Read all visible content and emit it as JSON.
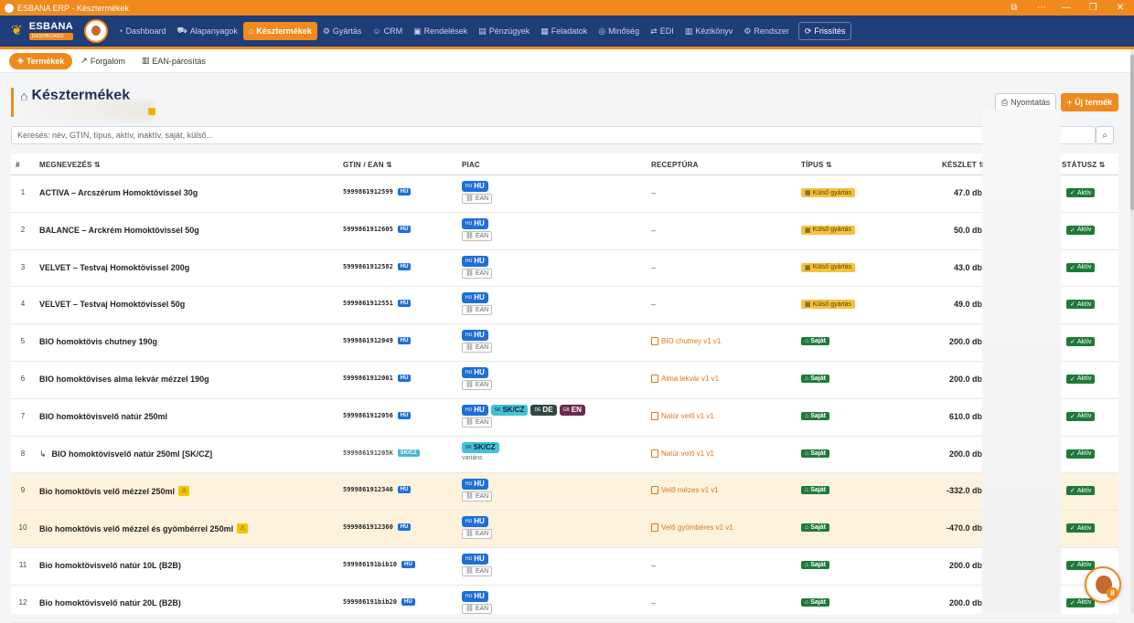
{
  "window": {
    "title": "ESBANA ERP - Késztermékek"
  },
  "brand": {
    "name": "ESBANA",
    "sub": "DASHBOARD"
  },
  "nav": {
    "items": [
      {
        "label": "Dashboard",
        "icon": "dashboard-icon"
      },
      {
        "label": "Alapanyagok",
        "icon": "cart-icon"
      },
      {
        "label": "Késztermékek",
        "icon": "tag-icon"
      },
      {
        "label": "Gyártás",
        "icon": "gear-icon"
      },
      {
        "label": "CRM",
        "icon": "users-icon"
      },
      {
        "label": "Rendelések",
        "icon": "inbox-icon"
      },
      {
        "label": "Pénzügyek",
        "icon": "money-icon"
      },
      {
        "label": "Feladatok",
        "icon": "board-icon"
      },
      {
        "label": "Minőség",
        "icon": "check-circle-icon"
      },
      {
        "label": "EDI",
        "icon": "transfer-icon"
      },
      {
        "label": "Kézikönyv",
        "icon": "book-icon"
      },
      {
        "label": "Rendszer",
        "icon": "settings-icon"
      }
    ],
    "refresh": "Frissítés"
  },
  "subnav": {
    "products": "Termékek",
    "turnover": "Forgalom",
    "ean_pairing": "EAN-párosítás"
  },
  "page": {
    "title": "Késztermékek",
    "print": "Nyomtatás",
    "new_product": "Új termék"
  },
  "search": {
    "placeholder": "Keresés: név, GTIN, típus, aktív, inaktív, saját, külső..."
  },
  "table": {
    "headers": {
      "idx": "#",
      "name": "MEGNEVEZÉS ⇅",
      "gtin": "GTIN / EAN ⇅",
      "market": "PIAC",
      "recipe": "RECEPTÚRA",
      "type": "TÍPUS ⇅",
      "stock": "KÉSZLET ⇅",
      "status": "STÁTUSZ ⇅"
    },
    "rows": [
      {
        "idx": "1",
        "name": "ACTIVA – Arcszérum Homoktövissel 30g",
        "gtin": "5999861912599",
        "recipe": "–",
        "type": "Külső gyártás",
        "stock": "47.0 db",
        "status": "Aktív"
      },
      {
        "idx": "2",
        "name": "BALANCE – Arckrém Homoktövissel 50g",
        "gtin": "5999861912605",
        "recipe": "–",
        "type": "Külső gyártás",
        "stock": "50.0 db",
        "status": "Aktív"
      },
      {
        "idx": "3",
        "name": "VELVET – Testvaj Homoktövissel 200g",
        "gtin": "5999861912582",
        "recipe": "–",
        "type": "Külső gyártás",
        "stock": "43.0 db",
        "status": "Aktív"
      },
      {
        "idx": "4",
        "name": "VELVET – Testvaj Homoktövissel 50g",
        "gtin": "5999861912551",
        "recipe": "–",
        "type": "Külső gyártás",
        "stock": "49.0 db",
        "status": "Aktív"
      },
      {
        "idx": "5",
        "name": "BIO homoktövis chutney 190g",
        "gtin": "5999861912049",
        "recipe": "BIO chutney v1 v1",
        "type": "Saját",
        "stock": "200.0 db",
        "status": "Aktív"
      },
      {
        "idx": "6",
        "name": "BIO homoktövises alma lekvár mézzel 190g",
        "gtin": "5999861912001",
        "recipe": "Alma lekvár v1 v1",
        "type": "Saját",
        "stock": "200.0 db",
        "status": "Aktív"
      },
      {
        "idx": "7",
        "name": "BIO homoktövisvelő natúr 250ml",
        "gtin": "5999861912056",
        "recipe": "Natúr velő v1 v1",
        "type": "Saját",
        "stock": "610.0 db",
        "status": "Aktív"
      },
      {
        "idx": "8",
        "variant_marker": "↳",
        "name": "BIO homoktövisvelő natúr 250ml [SK/CZ]",
        "gtin": "599986191205K",
        "gtin_tag": "SK/CZ",
        "variant_label": "variáns",
        "recipe": "Natúr velő v1 v1",
        "type": "Saját",
        "stock": "200.0 db",
        "status": "Aktív"
      },
      {
        "idx": "9",
        "name": "Bio homoktövis velő mézzel 250ml",
        "warn": "⚠",
        "gtin": "5999861912346",
        "recipe": "Velő mézes v1 v1",
        "type": "Saját",
        "stock": "-332.0 db",
        "status": "Aktív"
      },
      {
        "idx": "10",
        "name": "Bio homoktövis velő mézzel és gyömbérrel 250ml",
        "warn": "⚠",
        "gtin": "5999861912360",
        "recipe": "Velő gyömbéres v1 v1",
        "type": "Saját",
        "stock": "-470.0 db",
        "status": "Aktív"
      },
      {
        "idx": "11",
        "name": "Bio homoktövisvelő natúr 10L (B2B)",
        "gtin": "599986191bib10",
        "recipe": "–",
        "type": "Saját",
        "stock": "200.0 db",
        "status": "Aktív"
      },
      {
        "idx": "12",
        "name": "Bio homoktövisvelő natúr 20L (B2B)",
        "gtin": "599986191bib20",
        "recipe": "–",
        "type": "Saját",
        "stock": "200.0 db",
        "status": "Aktív"
      }
    ]
  },
  "markets": {
    "hu": {
      "code": "HU",
      "flag": "HU"
    },
    "sk": {
      "code": "SK/CZ",
      "flag": "SK"
    },
    "de": {
      "code": "DE",
      "flag": "DE"
    },
    "gb": {
      "code": "EN",
      "flag": "GB"
    },
    "ean": "EAN",
    "gtin_tag": "HU"
  },
  "colors": {
    "accent": "#f08a1c",
    "nav_bg": "#1f3d78",
    "own_green": "#1f7a3a",
    "external_yellow": "#f6c23e",
    "warn_row": "#fdf3dc"
  }
}
